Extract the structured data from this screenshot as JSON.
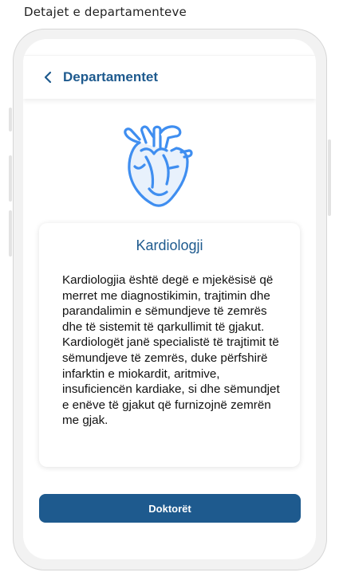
{
  "page": {
    "caption": "Detajet e departamenteve"
  },
  "header": {
    "title": "Departamentet",
    "back_icon": "chevron-left-icon"
  },
  "hero": {
    "icon": "heart-icon",
    "color": "#3f8ef0"
  },
  "card": {
    "title": "Kardiologji",
    "description": "Kardiologjia është degë e mjekësisë që merret me diagnostikimin, trajtimin dhe parandalimin e sëmundjeve të zemrës dhe të sistemit të qarkullimit të gjakut. Kardiologët janë specialistë të trajtimit të sëmundjeve të zemrës, duke përfshirë infarktin e miokardit, aritmive, insuficiencën kardiake, si dhe sëmundjet e enëve të gjakut që furnizojnë zemrën me gjak."
  },
  "actions": {
    "doctors_label": "Doktorët"
  },
  "colors": {
    "primary": "#1e5a8e",
    "accent": "#3f8ef0"
  }
}
